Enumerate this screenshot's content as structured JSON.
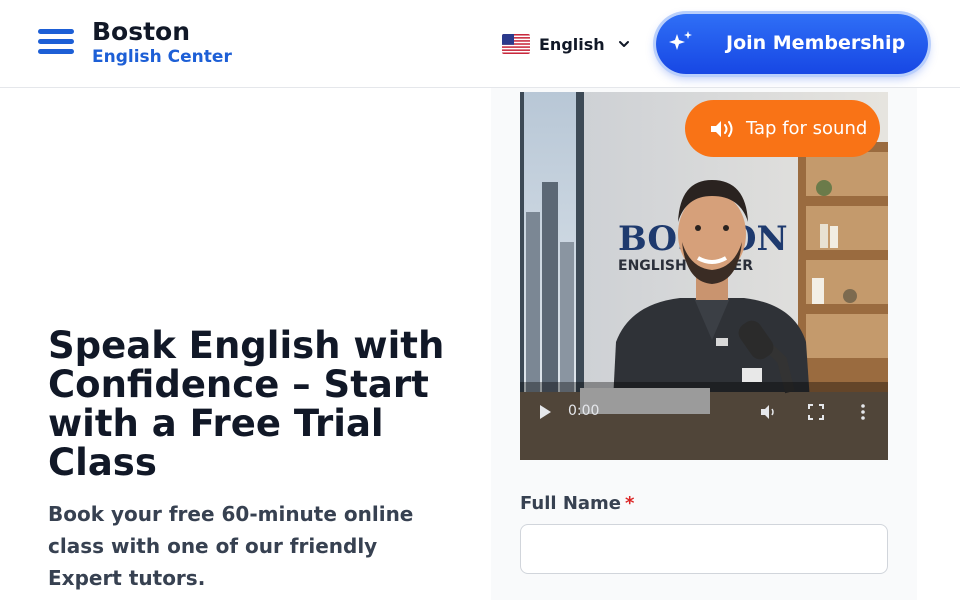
{
  "header": {
    "brand_name": "Boston",
    "brand_sub": "English Center",
    "language": "English",
    "join_label": "Join Membership"
  },
  "hero": {
    "title": "Speak English with Confidence – Start with a Free Trial Class",
    "subtitle": "Book your free 60-minute online class with one of our friendly Expert tutors."
  },
  "video": {
    "sound_label": "Tap for sound",
    "current_time": "0:00",
    "progress": 0,
    "wall_sign_line1": "BOSTON",
    "wall_sign_line2": "ENGLISH CENTER"
  },
  "form": {
    "full_name_label": "Full Name",
    "required_mark": "*",
    "full_name_value": ""
  },
  "colors": {
    "brand_blue": "#1d5fd6",
    "join_button": "#1f57ee",
    "sound_button": "#f97316",
    "required": "#dc2626"
  },
  "icons": {
    "menu": "hamburger-menu-icon",
    "flag": "us-flag-icon",
    "dropdown": "chevron-down-icon",
    "join": "sparkles-icon",
    "sound": "speaker-icon",
    "play": "play-icon",
    "volume": "volume-icon",
    "fullscreen": "fullscreen-icon",
    "more": "more-vertical-icon"
  }
}
